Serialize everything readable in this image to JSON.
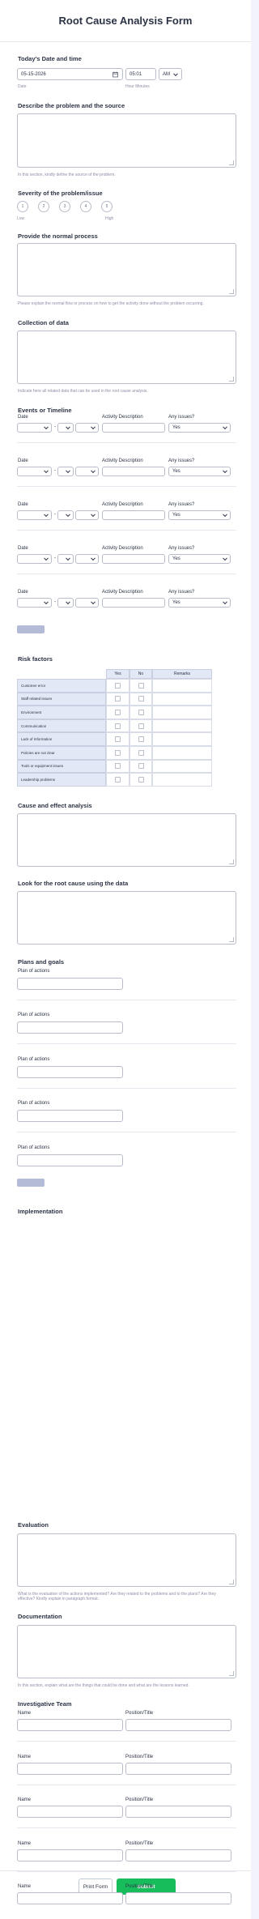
{
  "form": {
    "title": "Root Cause Analysis Form"
  },
  "date_time": {
    "label": "Today's Date and time",
    "date_value": "05-15-2026",
    "date_sublabel": "Date",
    "time_value": "05:01",
    "time_sublabel": "Hour Minutes",
    "ampm_value": "AM"
  },
  "problem": {
    "label": "Describe the problem and the source",
    "help": "In this section, kindly define the source of the problem."
  },
  "severity": {
    "label": "Severity of the problem/issue",
    "options": [
      "1",
      "2",
      "3",
      "4",
      "5"
    ],
    "low_label": "Low",
    "high_label": "High"
  },
  "normal_process": {
    "label": "Provide the normal process",
    "help": "Please explain the normal flow or process on how to get the activity done without the problem occurring."
  },
  "collection": {
    "label": "Collection of data",
    "help": "Indicate here all related data that can be used in the root cause analysis."
  },
  "events": {
    "label": "Events or Timeline",
    "col_date": "Date",
    "col_activity": "Activity Description",
    "col_issues": "Any issues?",
    "issue_value": "Yes",
    "date_separator": "-",
    "rows": 5,
    "add_label": ""
  },
  "risk": {
    "label": "Risk factors",
    "col_yes": "Yes",
    "col_no": "No",
    "col_remarks": "Remarks",
    "rows": [
      "Customer error",
      "Staff related issues",
      "Environment",
      "Communication",
      "Lack of Information",
      "Policies are not clear",
      "Tools or equipment issues",
      "Leadership problems"
    ]
  },
  "cause_effect": {
    "label": "Cause and effect analysis"
  },
  "look_root": {
    "label": "Look for the root cause using the data"
  },
  "plans": {
    "label": "Plans and goals",
    "field_label": "Plan of actions",
    "rows": 5
  },
  "implementation": {
    "label": "Implementation"
  },
  "evaluation": {
    "label": "Evaluation",
    "help_line1": "What is the evaluation of the actions implemented? Are they related to the problems and to the plans? Are they",
    "help_line2": "effective? Kindly explain in paragraph format."
  },
  "documentation": {
    "label": "Documentation",
    "help": "In this section, explain what are the things that could be done and what are the lessons learned."
  },
  "team": {
    "label": "Investigative Team",
    "name_label": "Name",
    "position_label": "Position/Title",
    "rows": 5
  },
  "buttons": {
    "print": "Print Form",
    "submit": "Submit"
  },
  "colors": {
    "submit": "#18bd5b",
    "add_button": "#b4bbd6",
    "table_header": "#e3e8f6"
  }
}
